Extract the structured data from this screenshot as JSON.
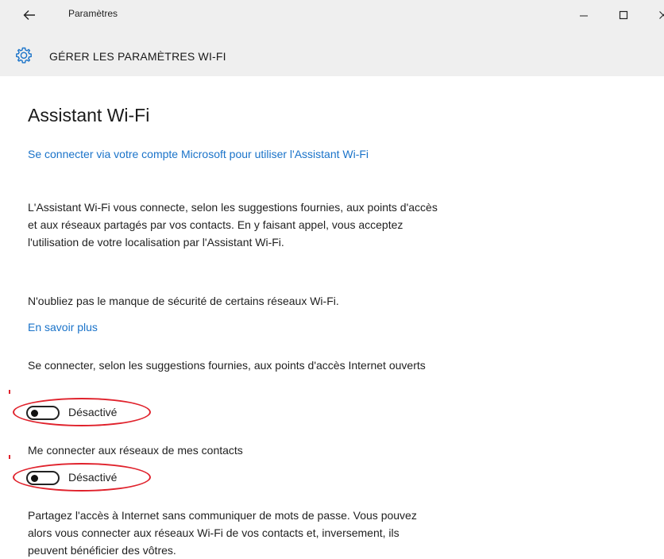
{
  "window": {
    "back_icon": "arrow-left-icon",
    "app_title": "Paramètres",
    "minimize_icon": "minimize-icon",
    "maximize_icon": "maximize-icon",
    "close_icon": "close-icon"
  },
  "header": {
    "icon": "gear-icon",
    "title": "GÉRER LES PARAMÈTRES WI-FI"
  },
  "main": {
    "section_title": "Assistant Wi-Fi",
    "signin_link": "Se connecter via votre compte Microsoft pour utiliser l'Assistant Wi-Fi",
    "description": "L'Assistant Wi-Fi vous connecte, selon les suggestions fournies, aux points d'accès et aux réseaux partagés par vos contacts. En y faisant appel, vous acceptez l'utilisation de votre localisation par l'Assistant Wi-Fi.",
    "warning": "N'oubliez pas le manque de sécurité de certains réseaux Wi-Fi.",
    "learn_more": "En savoir plus",
    "open_hotspots": {
      "label": "Se connecter, selon les suggestions fournies, aux points d'accès Internet ouverts",
      "state": "Désactivé"
    },
    "contacts_networks": {
      "label": "Me connecter aux réseaux de mes contacts",
      "state": "Désactivé"
    },
    "share_description": "Partagez l'accès à Internet sans communiquer de mots de passe. Vous pouvez alors vous connecter aux réseaux Wi-Fi de vos contacts et, inversement, ils peuvent bénéficier des vôtres."
  },
  "colors": {
    "accent_link": "#1a73c9",
    "annotation": "#e0222c",
    "titlebar_bg": "#efefef"
  }
}
